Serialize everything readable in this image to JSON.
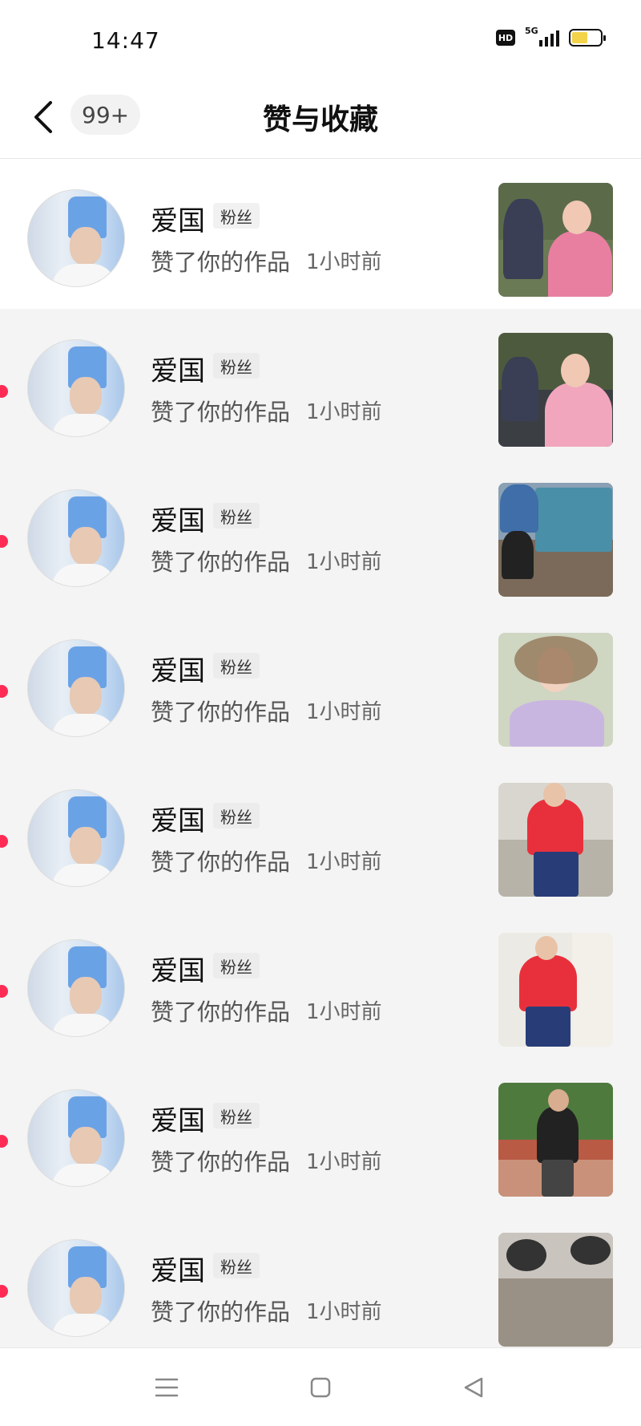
{
  "status_bar": {
    "time": "14:47",
    "hd_label": "HD",
    "network_label": "5G",
    "battery_color": "#f3d34a",
    "battery_level": 0.55
  },
  "header": {
    "back_icon": "chevron-left-icon",
    "count_badge": "99+",
    "title": "赞与收藏"
  },
  "notifications": [
    {
      "name": "爱国",
      "badge": "粉丝",
      "action": "赞了你的作品",
      "time": "1小时前",
      "unread": false
    },
    {
      "name": "爱国",
      "badge": "粉丝",
      "action": "赞了你的作品",
      "time": "1小时前",
      "unread": true
    },
    {
      "name": "爱国",
      "badge": "粉丝",
      "action": "赞了你的作品",
      "time": "1小时前",
      "unread": true
    },
    {
      "name": "爱国",
      "badge": "粉丝",
      "action": "赞了你的作品",
      "time": "1小时前",
      "unread": true
    },
    {
      "name": "爱国",
      "badge": "粉丝",
      "action": "赞了你的作品",
      "time": "1小时前",
      "unread": true
    },
    {
      "name": "爱国",
      "badge": "粉丝",
      "action": "赞了你的作品",
      "time": "1小时前",
      "unread": true
    },
    {
      "name": "爱国",
      "badge": "粉丝",
      "action": "赞了你的作品",
      "time": "1小时前",
      "unread": true
    },
    {
      "name": "爱国",
      "badge": "粉丝",
      "action": "赞了你的作品",
      "time": "1小时前",
      "unread": true
    }
  ],
  "colors": {
    "unread_dot": "#fe2c55",
    "page_bg": "#f4f4f4"
  },
  "nav_bar": {
    "icons": [
      "menu-icon",
      "home-square-icon",
      "back-triangle-icon"
    ]
  }
}
